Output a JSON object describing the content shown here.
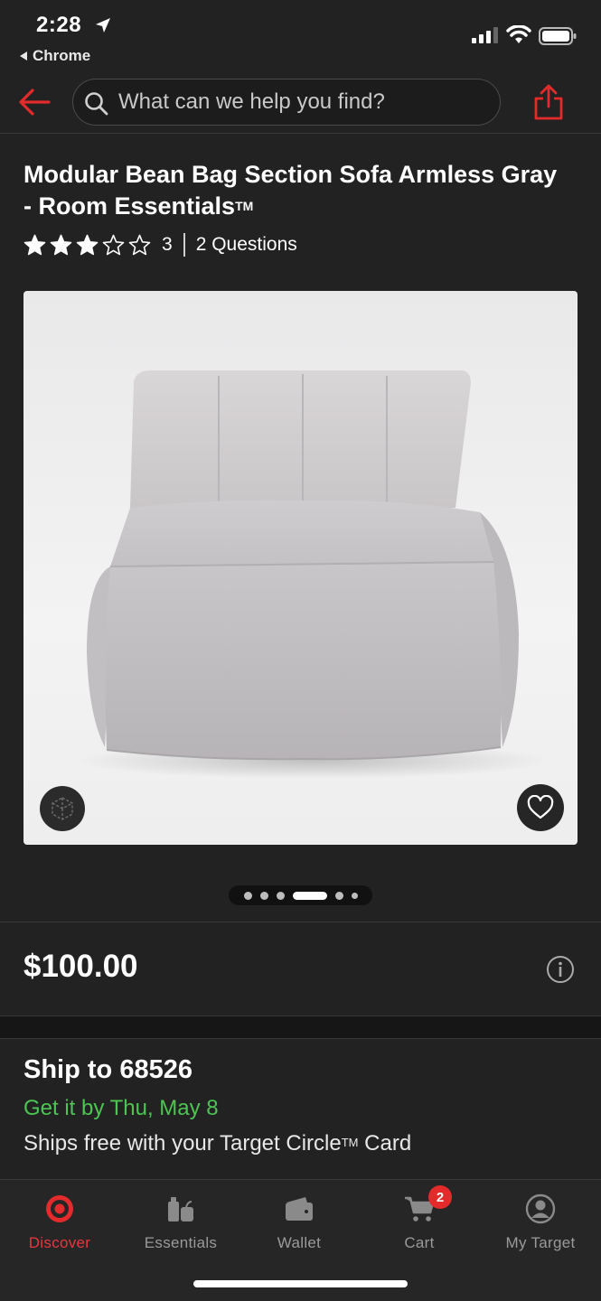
{
  "status_bar": {
    "time": "2:28",
    "back_app": "Chrome"
  },
  "header": {
    "search_placeholder": "What can we help you find?"
  },
  "product": {
    "title": "Modular Bean Bag Section Sofa Armless Gray - Room Essentials",
    "trademark": "TM",
    "rating": 3,
    "rating_max": 5,
    "rating_count": "3",
    "questions": "2 Questions",
    "image_subject": "gray armless bean bag sofa section",
    "carousel": {
      "total": 6,
      "active_index": 3
    },
    "price": "$100.00"
  },
  "shipping": {
    "title": "Ship to 68526",
    "delivery": "Get it by Thu, May 8",
    "free_prefix": "Ships free with your Target Circle",
    "free_tm": "TM",
    "free_suffix": " Card"
  },
  "tabs": [
    {
      "label": "Discover",
      "icon": "target-bullseye-icon",
      "active": true
    },
    {
      "label": "Essentials",
      "icon": "essentials-icon",
      "active": false
    },
    {
      "label": "Wallet",
      "icon": "wallet-icon",
      "active": false
    },
    {
      "label": "Cart",
      "icon": "cart-icon",
      "active": false,
      "badge": "2"
    },
    {
      "label": "My Target",
      "icon": "account-icon",
      "active": false
    }
  ],
  "colors": {
    "accent_red": "#e32b2b",
    "success_green": "#4cc552",
    "background": "#222222"
  }
}
